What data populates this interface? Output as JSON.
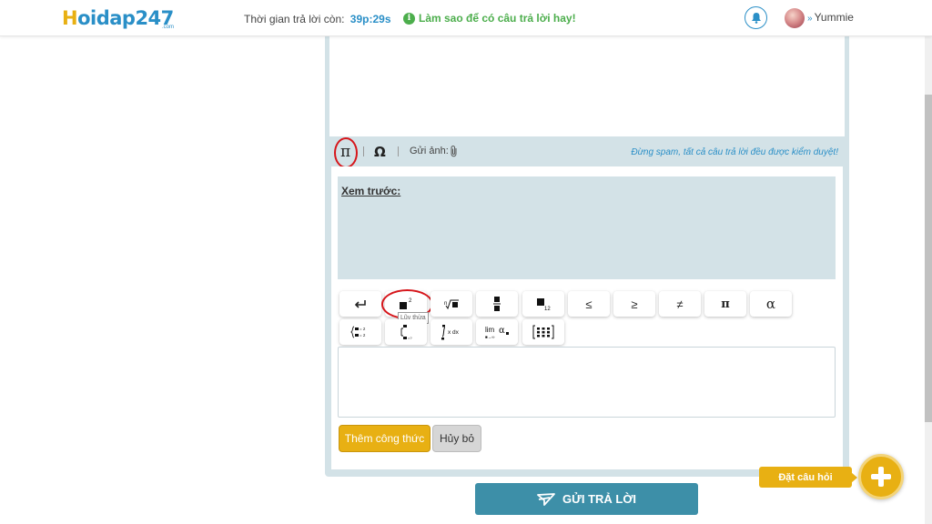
{
  "header": {
    "logo_first": "H",
    "logo_rest": "oidap247",
    "logo_sub": ".com",
    "timer_label": "Thời gian trả lời còn:",
    "timer_value": "39p:29s",
    "tip_text": "Làm sao để có câu trả lời hay!",
    "username": "Yummie"
  },
  "toolbar": {
    "pi_symbol": "π",
    "omega_symbol": "Ω",
    "image_label": "Gửi ảnh:",
    "warning": "Đừng spam, tất cả câu trả lời đều được kiểm duyệt!"
  },
  "preview": {
    "label": "Xem trước:"
  },
  "math_buttons": {
    "leq": "≤",
    "geq": "≥",
    "neq": "≠",
    "pi": "π",
    "alpha": "α",
    "power_tooltip": "Lũy thừa"
  },
  "actions": {
    "add_formula": "Thêm công thức",
    "cancel": "Hủy bỏ",
    "submit": "GỬI TRẢ LỜI",
    "ask": "Đặt câu hỏi"
  },
  "colors": {
    "accent_blue": "#2a8fc7",
    "accent_yellow": "#e8b013",
    "submit_teal": "#3d8fa8",
    "highlight_red": "#d6161b",
    "panel_bg": "#d3e2e7"
  }
}
